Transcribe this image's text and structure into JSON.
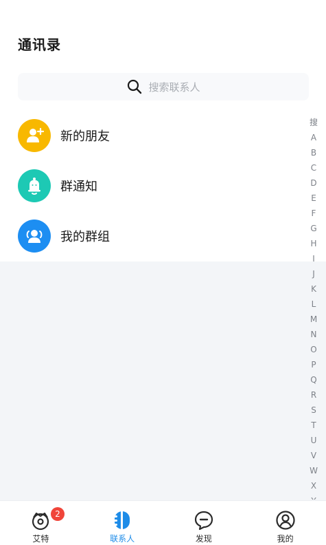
{
  "header": {
    "title": "通讯录"
  },
  "search": {
    "placeholder": "搜索联系人",
    "icon": "search-icon"
  },
  "menu": [
    {
      "label": "新的朋友",
      "icon": "add-friend-icon",
      "color": "#f8b800"
    },
    {
      "label": "群通知",
      "icon": "bell-icon",
      "color": "#1dc9b4"
    },
    {
      "label": "我的群组",
      "icon": "group-icon",
      "color": "#1d8ef2"
    }
  ],
  "index_bar": [
    "搜",
    "A",
    "B",
    "C",
    "D",
    "E",
    "F",
    "G",
    "H",
    "I",
    "J",
    "K",
    "L",
    "M",
    "N",
    "O",
    "P",
    "Q",
    "R",
    "S",
    "T",
    "U",
    "V",
    "W",
    "X",
    "Y"
  ],
  "tabs": [
    {
      "label": "艾特",
      "icon": "at-face-icon",
      "badge": "2",
      "active": false
    },
    {
      "label": "联系人",
      "icon": "contacts-icon",
      "active": true
    },
    {
      "label": "发现",
      "icon": "discover-chat-icon",
      "active": false
    },
    {
      "label": "我的",
      "icon": "profile-icon",
      "active": false
    }
  ],
  "colors": {
    "active_tab": "#1e8ce8",
    "badge": "#f0453a"
  }
}
